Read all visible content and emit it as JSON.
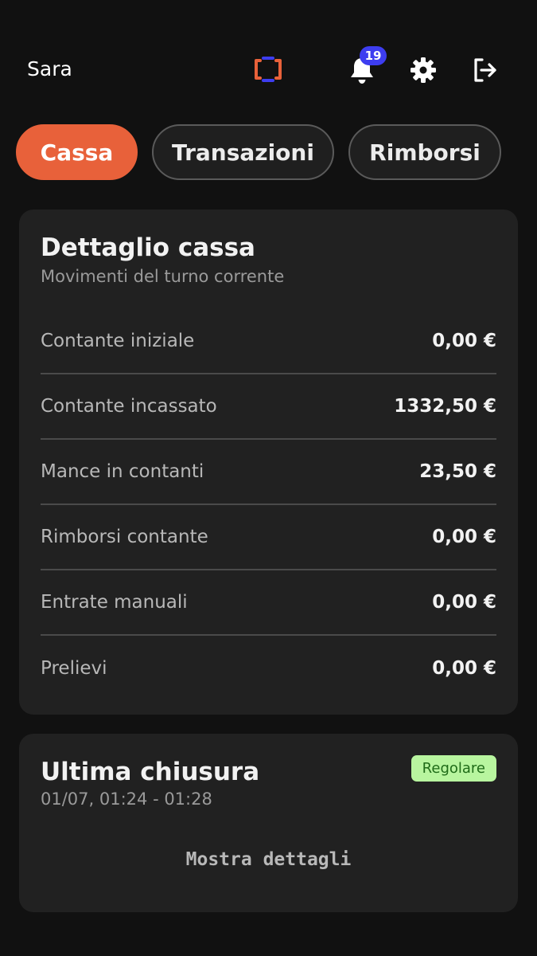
{
  "header": {
    "user_name": "Sara",
    "logo_icon": "brackets-logo-icon",
    "notification_count": "19",
    "icons": [
      "bell-icon",
      "gear-icon",
      "logout-icon"
    ],
    "colors": {
      "accent": "#e8613a",
      "logo_blue": "#3d3df0",
      "badge": "#3d3df0"
    }
  },
  "tabs": [
    {
      "label": "Cassa",
      "active": true
    },
    {
      "label": "Transazioni",
      "active": false
    },
    {
      "label": "Rimborsi",
      "active": false
    }
  ],
  "cash_detail": {
    "title": "Dettaglio cassa",
    "subtitle": "Movimenti del turno corrente",
    "rows": [
      {
        "label": "Contante iniziale",
        "value": "0,00 €"
      },
      {
        "label": "Contante incassato",
        "value": "1332,50 €"
      },
      {
        "label": "Mance in contanti",
        "value": "23,50 €"
      },
      {
        "label": "Rimborsi contante",
        "value": "0,00 €"
      },
      {
        "label": "Entrate manuali",
        "value": "0,00 €"
      },
      {
        "label": "Prelievi",
        "value": "0,00 €"
      }
    ]
  },
  "last_close": {
    "title": "Ultima chiusura",
    "time_range": "01/07, 01:24 - 01:28",
    "status": "Regolare",
    "details_label": "Mostra dettagli"
  }
}
